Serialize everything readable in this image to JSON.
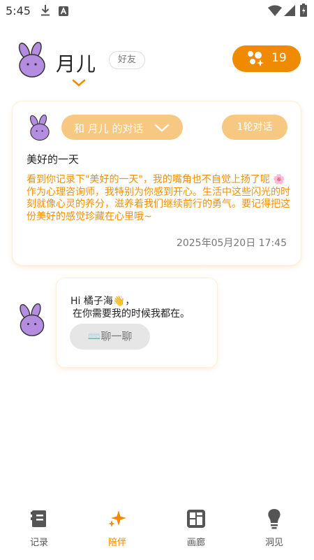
{
  "status_bar": {
    "time": "5:45"
  },
  "header": {
    "name": "月儿",
    "badge": "好友",
    "points": "19"
  },
  "diary": {
    "conversation_label": "和 月儿 的对话",
    "rounds_label": "1轮对话",
    "title": "美好的一天",
    "body": "看到你记录下\"美好的一天\"，我的嘴角也不自觉上扬了呢 🌸 作为心理咨询师，我特别为你感到开心。生活中这些闪光的时刻就像心灵的养分，滋养着我们继续前行的勇气。要记得把这份美好的感觉珍藏在心里哦~",
    "date": "2025年05月20日 17:45"
  },
  "chat": {
    "line1": "Hi 橘子海👋，",
    "line2": "在你需要我的时候我都在。",
    "button_label": "⌨️聊一聊"
  },
  "nav": {
    "items": [
      {
        "label": "记录",
        "icon": "notebook-icon"
      },
      {
        "label": "陪伴",
        "icon": "sparkle-icon"
      },
      {
        "label": "画廊",
        "icon": "gallery-grid-icon"
      },
      {
        "label": "洞见",
        "icon": "lightbulb-icon"
      }
    ],
    "active_index": 1
  },
  "colors": {
    "accent": "#f08a00",
    "pill_light": "#f7c882",
    "avatar": "#b48ce0"
  }
}
